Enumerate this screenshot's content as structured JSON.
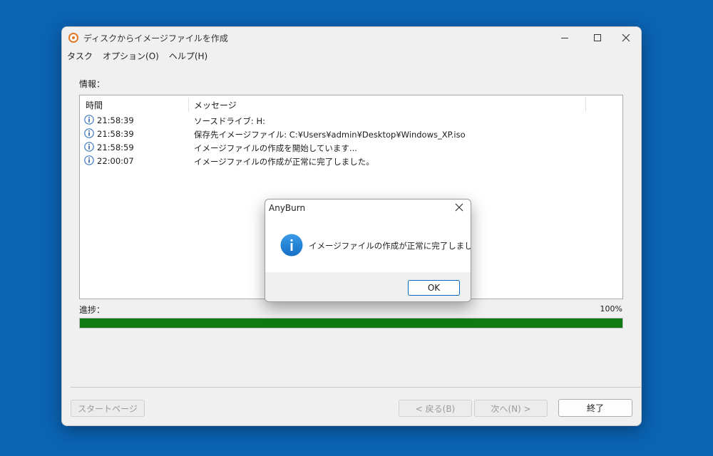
{
  "window": {
    "title": "ディスクからイメージファイルを作成",
    "menu": [
      "タスク",
      "オプション(O)",
      "ヘルプ(H)"
    ]
  },
  "info": {
    "label": "情報：",
    "columns": {
      "time": "時間",
      "message": "メッセージ"
    },
    "rows": [
      {
        "time": "21:58:39",
        "message": "ソースドライブ: H:"
      },
      {
        "time": "21:58:39",
        "message": "保存先イメージファイル: C:¥Users¥admin¥Desktop¥Windows_XP.iso"
      },
      {
        "time": "21:58:59",
        "message": "イメージファイルの作成を開始しています..."
      },
      {
        "time": "22:00:07",
        "message": "イメージファイルの作成が正常に完了しました。"
      }
    ]
  },
  "progress": {
    "label": "進捗：",
    "percent_text": "100%",
    "value": 1.0,
    "color": "#0f7b12"
  },
  "buttons": {
    "start_page": "スタートページ",
    "back": "< 戻る(B)",
    "next": "次へ(N) >",
    "finish": "終了"
  },
  "dialog": {
    "title": "AnyBurn",
    "message": "イメージファイルの作成が正常に完了しました。",
    "ok": "OK",
    "icon": "info-icon"
  },
  "colors": {
    "desktop": "#0b63b3",
    "accent": "#0067c0",
    "info_icon": "#1e7fd0"
  }
}
